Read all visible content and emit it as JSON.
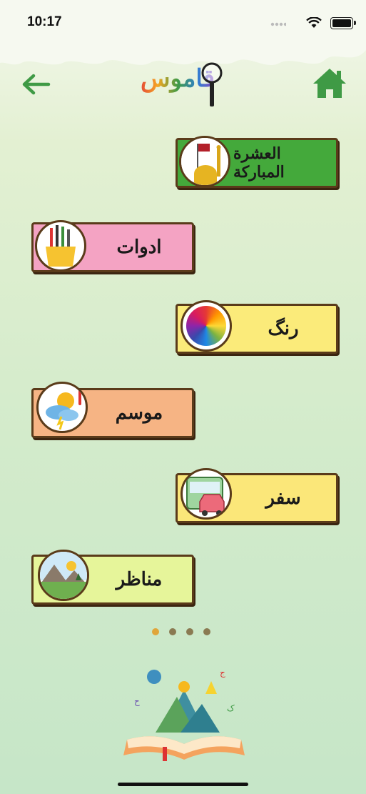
{
  "status_bar": {
    "time": "10:17"
  },
  "header": {
    "back_icon": "arrow-left-icon",
    "home_icon": "home-icon",
    "logo_text": "قاموس"
  },
  "categories": [
    {
      "label": "العشرة المبارکة",
      "color": "#44a93b",
      "icon": "shrine-icon"
    },
    {
      "label": "ادوات",
      "color": "#f4a3c3",
      "icon": "pencil-cup-icon"
    },
    {
      "label": "رنگ",
      "color": "#fbeb7a",
      "icon": "color-wheel-icon"
    },
    {
      "label": "موسم",
      "color": "#f6b484",
      "icon": "weather-icon"
    },
    {
      "label": "سفر",
      "color": "#fbe779",
      "icon": "bus-car-icon"
    },
    {
      "label": "مناظر",
      "color": "#e6f59a",
      "icon": "landscape-icon"
    }
  ],
  "pager": {
    "pages": 4,
    "active": 0,
    "dot_color": "#e0a53a"
  },
  "colors": {
    "accent_green": "#3f9a45",
    "frame_brown": "#5a3b1a"
  }
}
